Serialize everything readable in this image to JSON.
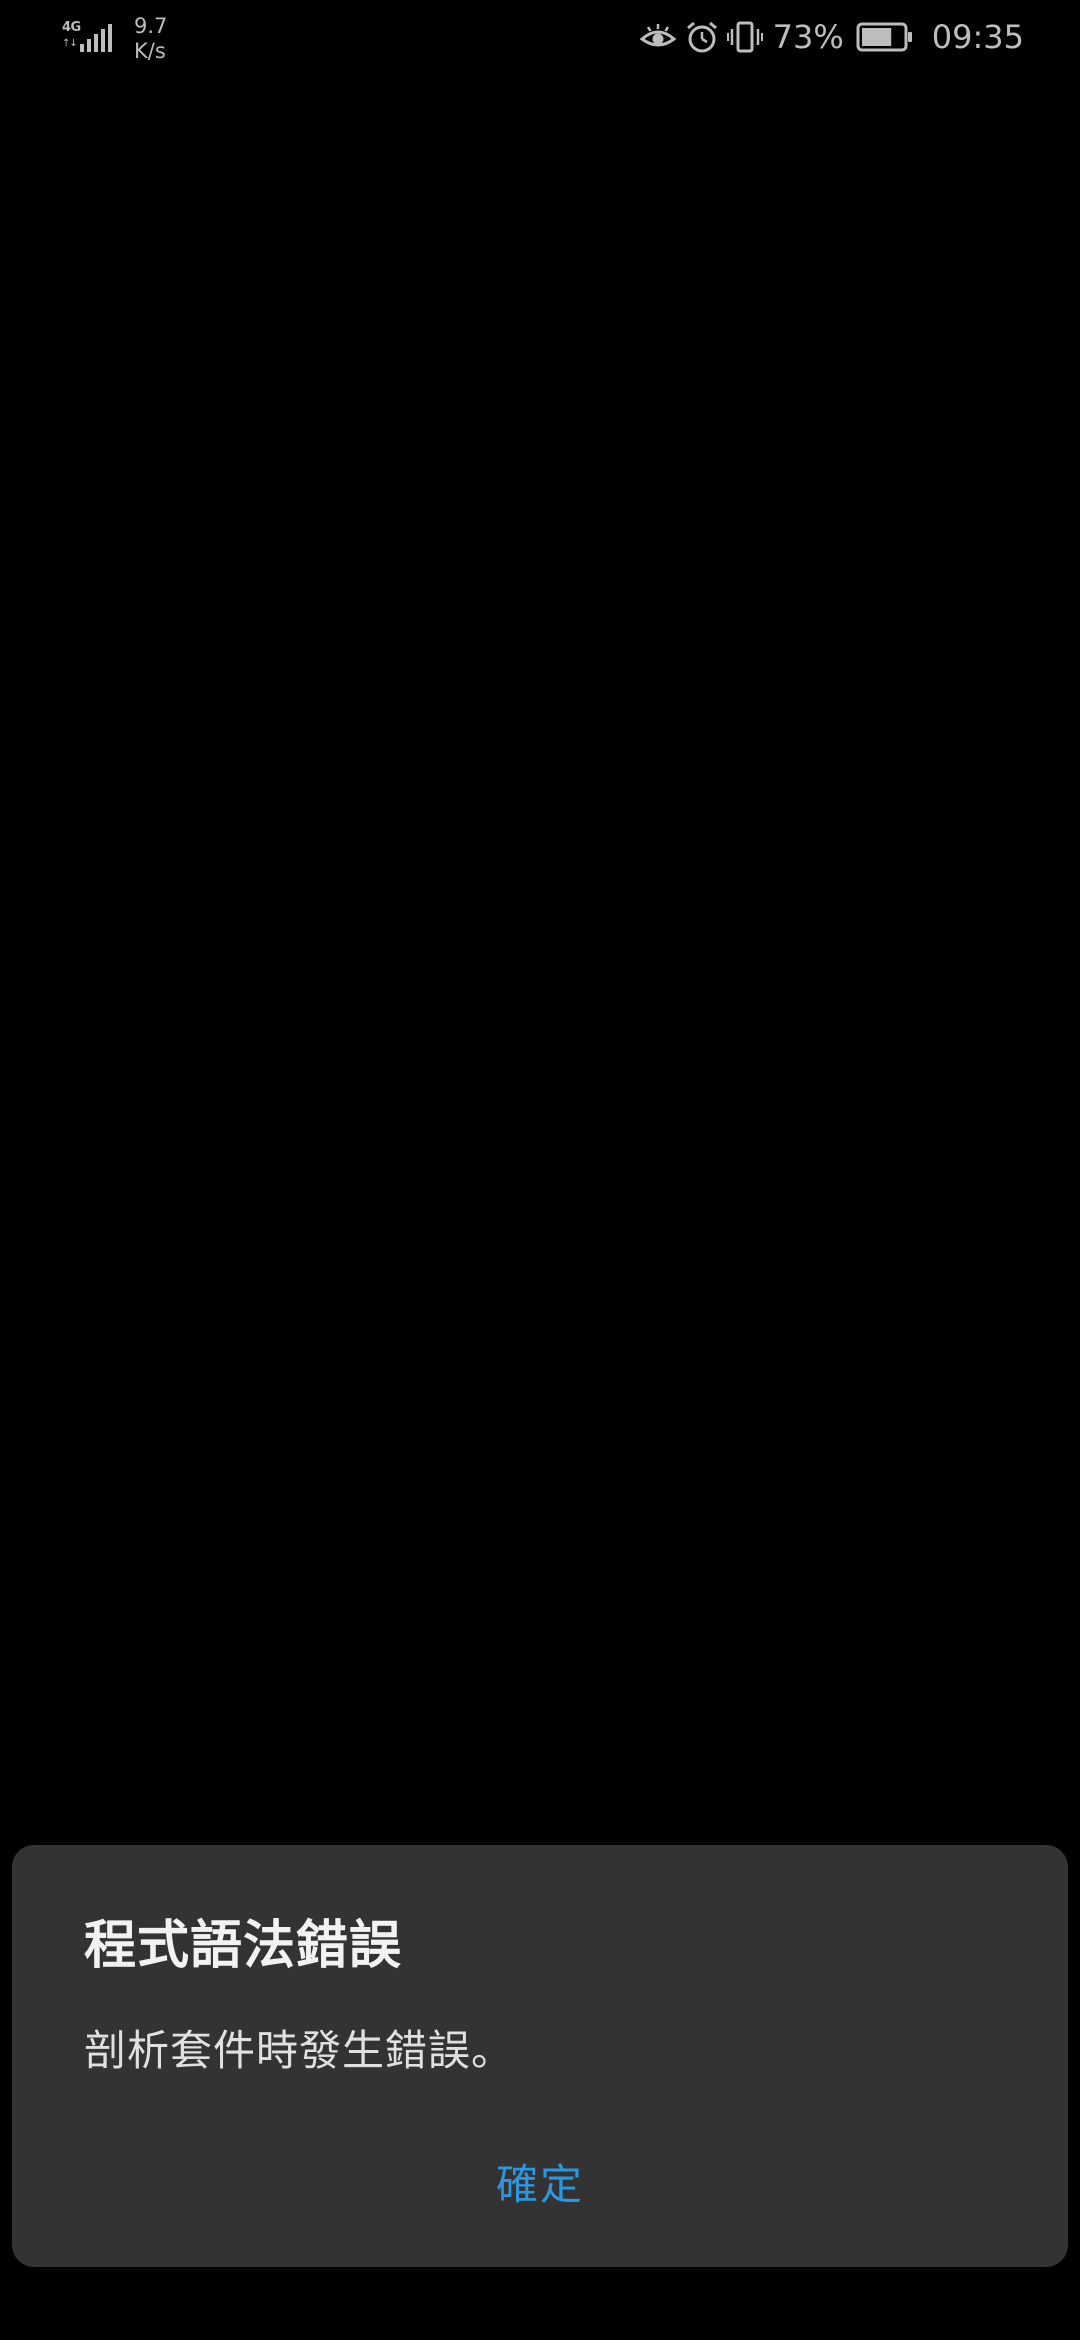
{
  "status_bar": {
    "network_type": "4G",
    "network_arrows": "↑↓",
    "speed_value": "9.7",
    "speed_unit": "K/s",
    "icons": [
      "eye-comfort-icon",
      "alarm-icon",
      "vibrate-icon",
      "battery-icon"
    ],
    "battery_percent": "73%",
    "battery_level": 0.73,
    "time": "09:35"
  },
  "dialog": {
    "title": "程式語法錯誤",
    "message": "剖析套件時發生錯誤。",
    "confirm_label": "確定"
  },
  "colors": {
    "background": "#000000",
    "dialog_background": "#333333",
    "accent": "#2c97de",
    "status_text": "#bdbdbd"
  }
}
